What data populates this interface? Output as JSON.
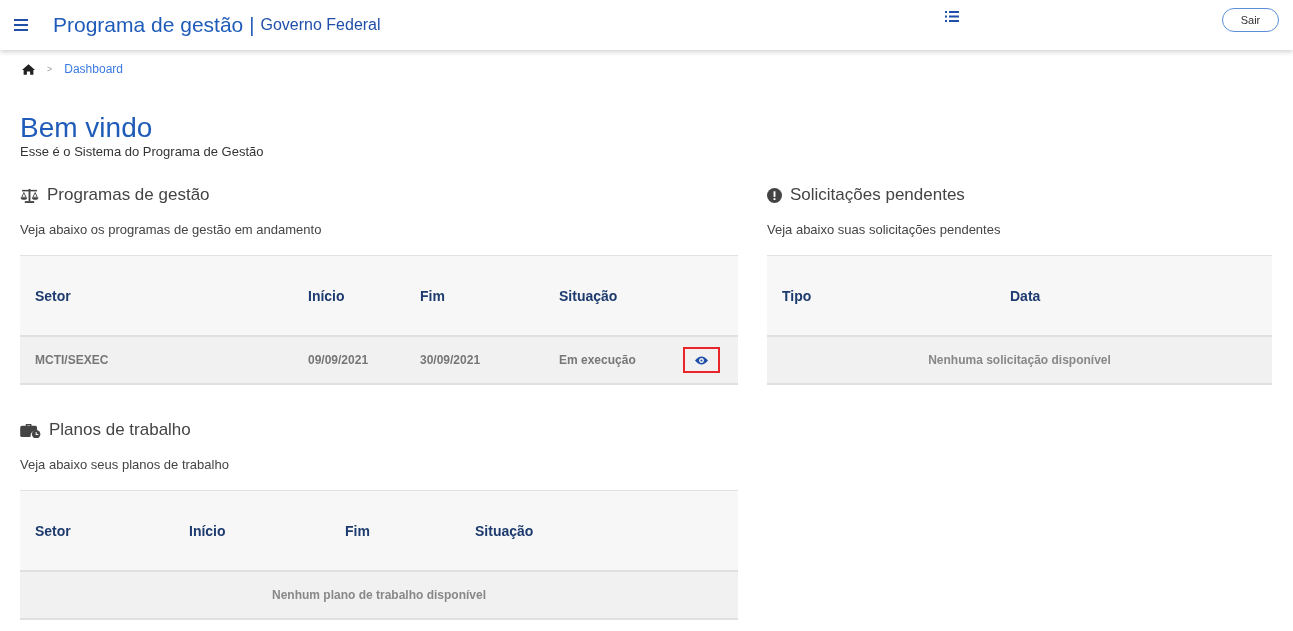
{
  "header": {
    "title": "Programa de gestão",
    "separator": "|",
    "subtitle": "Governo Federal",
    "logout": "Sair"
  },
  "breadcrumb": {
    "home_separator": ">",
    "items": [
      "Dashboard"
    ]
  },
  "welcome": {
    "title": "Bem vindo",
    "subtitle": "Esse é o Sistema do Programa de Gestão"
  },
  "sections": [
    {
      "kind": "programs",
      "title": "Programas de gestão",
      "description": "Veja abaixo os programas de gestão em andamento",
      "columns": [
        "Setor",
        "Início",
        "Fim",
        "Situação"
      ],
      "rows": [
        {
          "cells": [
            "MCTI/SEXEC",
            "09/09/2021",
            "30/09/2021",
            "Em execução"
          ],
          "view_highlighted": true
        }
      ]
    },
    {
      "kind": "plans",
      "title": "Planos de trabalho",
      "description": "Veja abaixo seus planos de trabalho",
      "columns": [
        "Setor",
        "Início",
        "Fim",
        "Situação"
      ],
      "empty": "Nenhum plano de trabalho disponível"
    },
    {
      "kind": "requests",
      "title": "Solicitações pendentes",
      "description": "Veja abaixo suas solicitações pendentes",
      "columns": [
        "Tipo",
        "Data"
      ],
      "empty": "Nenhuma solicitação disponível"
    }
  ]
}
